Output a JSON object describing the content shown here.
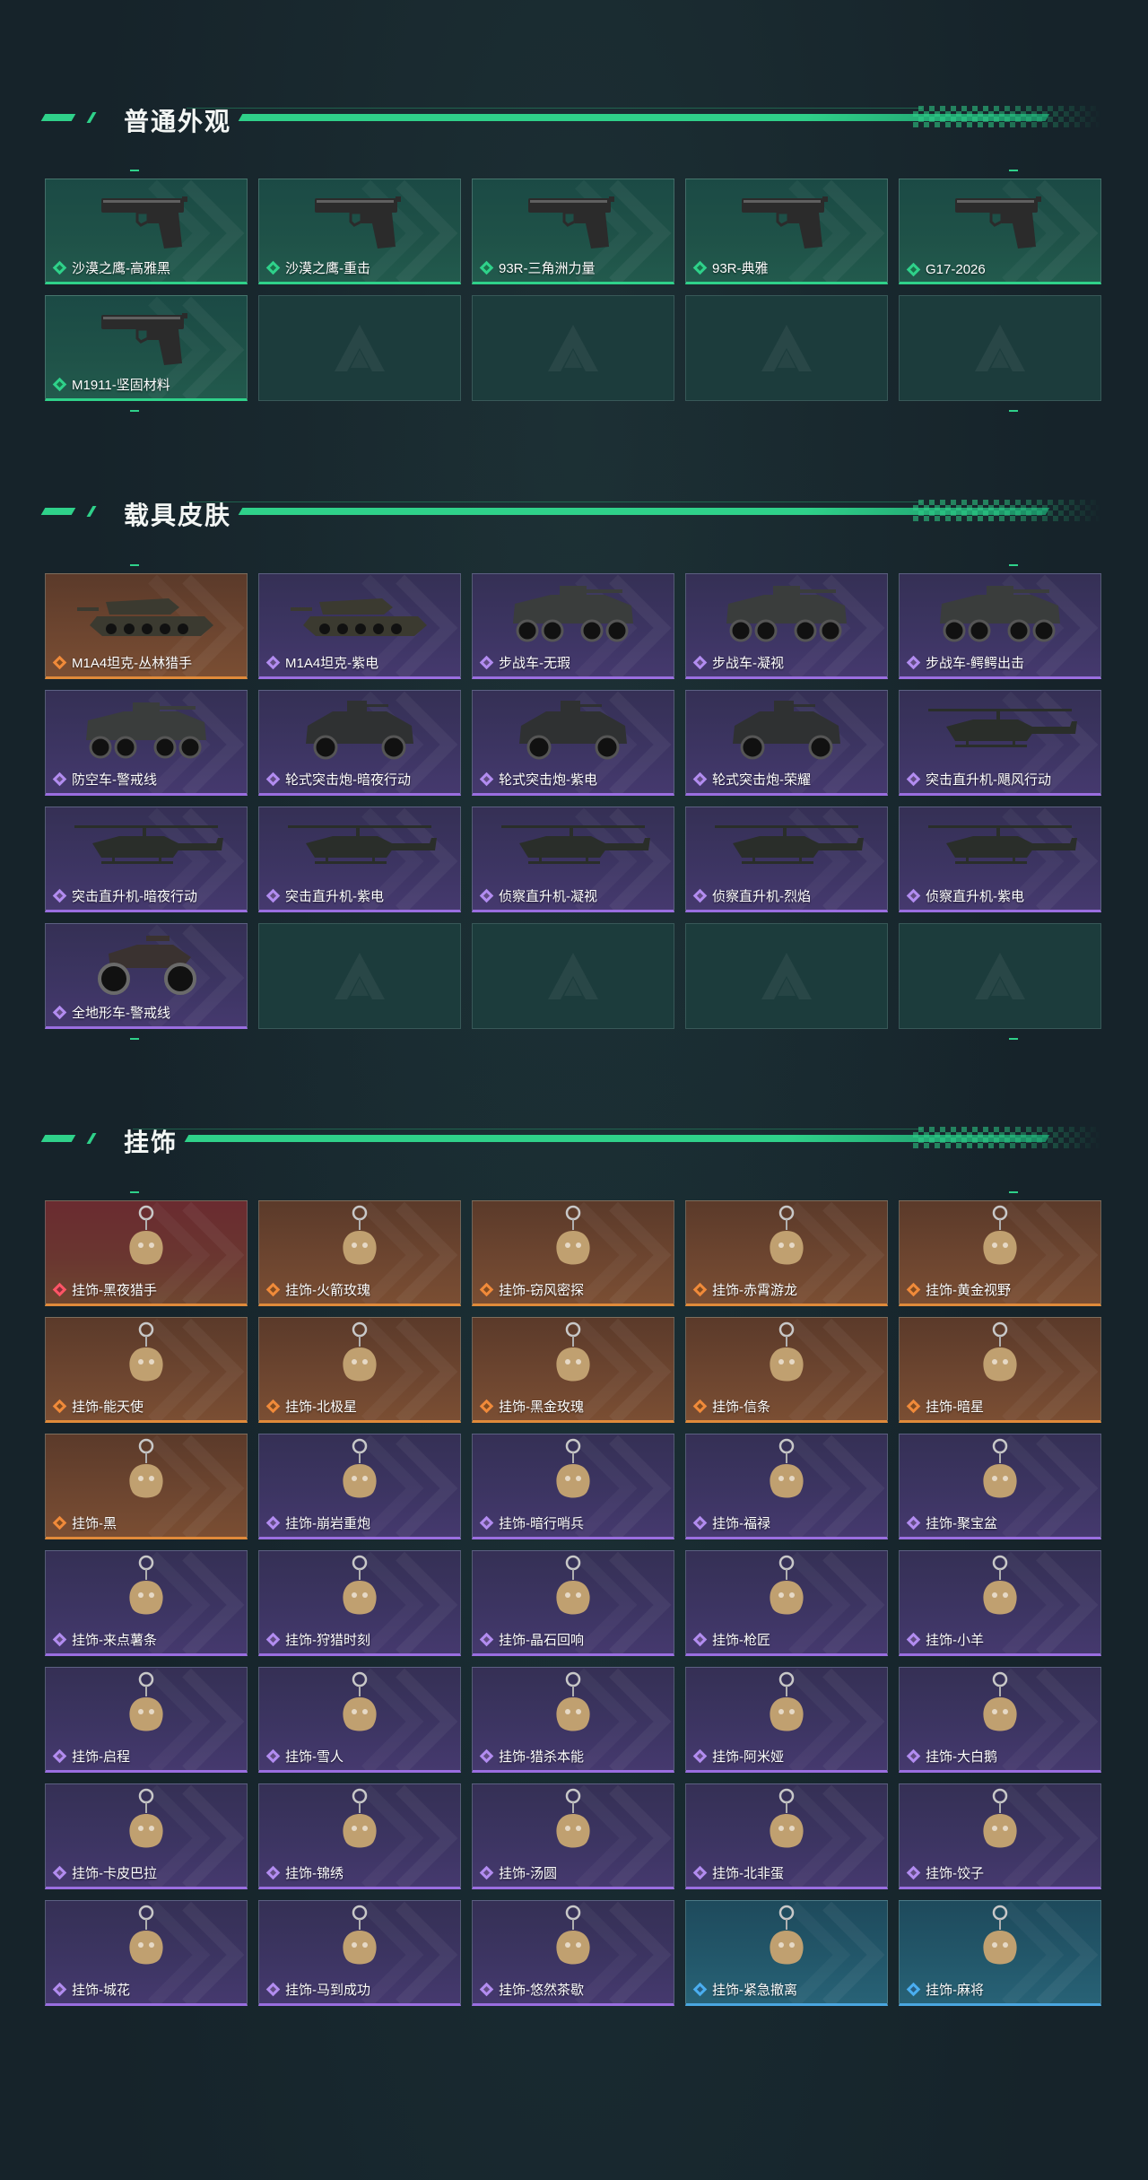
{
  "colors": {
    "accent": "#2fd18a",
    "rarity_green": "#2fd18a",
    "rarity_orange": "#e08a3a",
    "rarity_red": "#ff5566",
    "rarity_purple": "#9a6ee0",
    "rarity_blue": "#4aa6e0"
  },
  "sections": [
    {
      "title": "普通外观",
      "items": [
        {
          "label": "沙漠之鹰-高雅黑",
          "rarity": "green",
          "icon": "pistol-icon"
        },
        {
          "label": "沙漠之鹰-重击",
          "rarity": "green",
          "icon": "pistol-icon"
        },
        {
          "label": "93R-三角洲力量",
          "rarity": "green",
          "icon": "pistol-icon"
        },
        {
          "label": "93R-典雅",
          "rarity": "green",
          "icon": "pistol-icon"
        },
        {
          "label": "G17-2026",
          "rarity": "green",
          "icon": "pistol-icon"
        },
        {
          "label": "M1911-坚固材料",
          "rarity": "green",
          "icon": "pistol-icon"
        },
        {
          "empty": true
        },
        {
          "empty": true
        },
        {
          "empty": true
        },
        {
          "empty": true
        }
      ]
    },
    {
      "title": "载具皮肤",
      "items": [
        {
          "label": "M1A4坦克-丛林猎手",
          "rarity": "orange",
          "icon": "tank-icon"
        },
        {
          "label": "M1A4坦克-紫电",
          "rarity": "purple",
          "icon": "tank-icon"
        },
        {
          "label": "步战车-无瑕",
          "rarity": "purple",
          "icon": "ifv-icon"
        },
        {
          "label": "步战车-凝视",
          "rarity": "purple",
          "icon": "ifv-icon"
        },
        {
          "label": "步战车-鳄鳄出击",
          "rarity": "purple",
          "icon": "ifv-icon"
        },
        {
          "label": "防空车-警戒线",
          "rarity": "purple",
          "icon": "ifv-icon"
        },
        {
          "label": "轮式突击炮-暗夜行动",
          "rarity": "purple",
          "icon": "armored-car-icon"
        },
        {
          "label": "轮式突击炮-紫电",
          "rarity": "purple",
          "icon": "armored-car-icon"
        },
        {
          "label": "轮式突击炮-荣耀",
          "rarity": "purple",
          "icon": "armored-car-icon"
        },
        {
          "label": "突击直升机-飓风行动",
          "rarity": "purple",
          "icon": "helicopter-icon"
        },
        {
          "label": "突击直升机-暗夜行动",
          "rarity": "purple",
          "icon": "helicopter-icon"
        },
        {
          "label": "突击直升机-紫电",
          "rarity": "purple",
          "icon": "helicopter-icon"
        },
        {
          "label": "侦察直升机-凝视",
          "rarity": "purple",
          "icon": "helicopter-icon"
        },
        {
          "label": "侦察直升机-烈焰",
          "rarity": "purple",
          "icon": "helicopter-icon"
        },
        {
          "label": "侦察直升机-紫电",
          "rarity": "purple",
          "icon": "helicopter-icon"
        },
        {
          "label": "全地形车-警戒线",
          "rarity": "purple",
          "icon": "atv-icon"
        },
        {
          "empty": true
        },
        {
          "empty": true
        },
        {
          "empty": true
        },
        {
          "empty": true
        }
      ]
    },
    {
      "title": "挂饰",
      "items": [
        {
          "label": "挂饰-黑夜猎手",
          "rarity": "red",
          "icon": "charm-icon"
        },
        {
          "label": "挂饰-火箭玫瑰",
          "rarity": "orange",
          "icon": "charm-icon"
        },
        {
          "label": "挂饰-窃风密探",
          "rarity": "orange",
          "icon": "charm-icon"
        },
        {
          "label": "挂饰-赤霄游龙",
          "rarity": "orange",
          "icon": "charm-icon"
        },
        {
          "label": "挂饰-黄金视野",
          "rarity": "orange",
          "icon": "charm-icon"
        },
        {
          "label": "挂饰-能天使",
          "rarity": "orange",
          "icon": "charm-icon"
        },
        {
          "label": "挂饰-北极星",
          "rarity": "orange",
          "icon": "charm-icon"
        },
        {
          "label": "挂饰-黑金玫瑰",
          "rarity": "orange",
          "icon": "charm-icon"
        },
        {
          "label": "挂饰-信条",
          "rarity": "orange",
          "icon": "charm-icon"
        },
        {
          "label": "挂饰-暗星",
          "rarity": "orange",
          "icon": "charm-icon"
        },
        {
          "label": "挂饰-黑",
          "rarity": "orange",
          "icon": "charm-icon"
        },
        {
          "label": "挂饰-崩岩重炮",
          "rarity": "purple",
          "icon": "charm-icon"
        },
        {
          "label": "挂饰-暗行哨兵",
          "rarity": "purple",
          "icon": "charm-icon"
        },
        {
          "label": "挂饰-福禄",
          "rarity": "purple",
          "icon": "charm-icon"
        },
        {
          "label": "挂饰-聚宝盆",
          "rarity": "purple",
          "icon": "charm-icon"
        },
        {
          "label": "挂饰-来点薯条",
          "rarity": "purple",
          "icon": "charm-icon"
        },
        {
          "label": "挂饰-狩猎时刻",
          "rarity": "purple",
          "icon": "charm-icon"
        },
        {
          "label": "挂饰-晶石回响",
          "rarity": "purple",
          "icon": "charm-icon"
        },
        {
          "label": "挂饰-枪匠",
          "rarity": "purple",
          "icon": "charm-icon"
        },
        {
          "label": "挂饰-小羊",
          "rarity": "purple",
          "icon": "charm-icon"
        },
        {
          "label": "挂饰-启程",
          "rarity": "purple",
          "icon": "charm-icon"
        },
        {
          "label": "挂饰-雪人",
          "rarity": "purple",
          "icon": "charm-icon"
        },
        {
          "label": "挂饰-猎杀本能",
          "rarity": "purple",
          "icon": "charm-icon"
        },
        {
          "label": "挂饰-阿米娅",
          "rarity": "purple",
          "icon": "charm-icon"
        },
        {
          "label": "挂饰-大白鹅",
          "rarity": "purple",
          "icon": "charm-icon"
        },
        {
          "label": "挂饰-卡皮巴拉",
          "rarity": "purple",
          "icon": "charm-icon"
        },
        {
          "label": "挂饰-锦绣",
          "rarity": "purple",
          "icon": "charm-icon"
        },
        {
          "label": "挂饰-汤圆",
          "rarity": "purple",
          "icon": "charm-icon"
        },
        {
          "label": "挂饰-北非蛋",
          "rarity": "purple",
          "icon": "charm-icon"
        },
        {
          "label": "挂饰-饺子",
          "rarity": "purple",
          "icon": "charm-icon"
        },
        {
          "label": "挂饰-城花",
          "rarity": "purple",
          "icon": "charm-icon"
        },
        {
          "label": "挂饰-马到成功",
          "rarity": "purple",
          "icon": "charm-icon"
        },
        {
          "label": "挂饰-悠然茶歇",
          "rarity": "purple",
          "icon": "charm-icon"
        },
        {
          "label": "挂饰-紧急撤离",
          "rarity": "blue",
          "icon": "charm-icon"
        },
        {
          "label": "挂饰-麻将",
          "rarity": "blue",
          "icon": "charm-icon"
        }
      ]
    }
  ]
}
